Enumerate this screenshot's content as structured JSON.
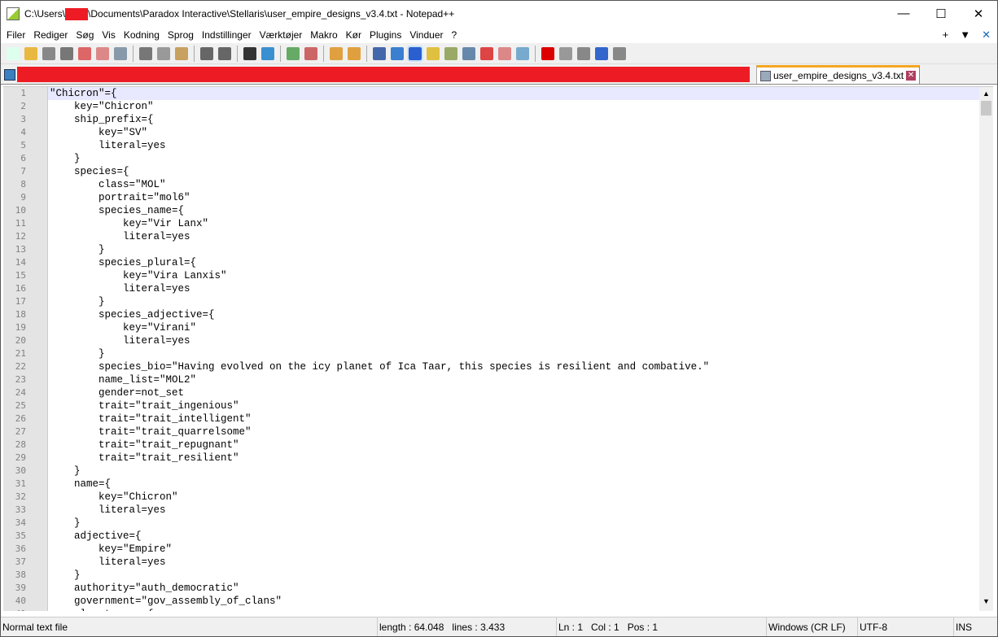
{
  "window": {
    "title_prefix": "C:\\Users\\",
    "title_suffix": "\\Documents\\Paradox Interactive\\Stellaris\\user_empire_designs_v3.4.txt - Notepad++",
    "minimize": "—",
    "maximize": "☐",
    "close": "✕"
  },
  "menu": [
    "Filer",
    "Rediger",
    "Søg",
    "Vis",
    "Kodning",
    "Sprog",
    "Indstillinger",
    "Værktøjer",
    "Makro",
    "Kør",
    "Plugins",
    "Vinduer",
    "?"
  ],
  "menu_right": {
    "plus": "+",
    "down": "▼",
    "close": "✕"
  },
  "tab": {
    "label": "user_empire_designs_v3.4.txt",
    "close": "✕"
  },
  "code_lines": [
    "\"Chicron\"={",
    "    key=\"Chicron\"",
    "    ship_prefix={",
    "        key=\"SV\"",
    "        literal=yes",
    "    }",
    "    species={",
    "        class=\"MOL\"",
    "        portrait=\"mol6\"",
    "        species_name={",
    "            key=\"Vir Lanx\"",
    "            literal=yes",
    "        }",
    "        species_plural={",
    "            key=\"Vira Lanxis\"",
    "            literal=yes",
    "        }",
    "        species_adjective={",
    "            key=\"Virani\"",
    "            literal=yes",
    "        }",
    "        species_bio=\"Having evolved on the icy planet of Ica Taar, this species is resilient and combative.\"",
    "        name_list=\"MOL2\"",
    "        gender=not_set",
    "        trait=\"trait_ingenious\"",
    "        trait=\"trait_intelligent\"",
    "        trait=\"trait_quarrelsome\"",
    "        trait=\"trait_repugnant\"",
    "        trait=\"trait_resilient\"",
    "    }",
    "    name={",
    "        key=\"Chicron\"",
    "        literal=yes",
    "    }",
    "    adjective={",
    "        key=\"Empire\"",
    "        literal=yes",
    "    }",
    "    authority=\"auth_democratic\"",
    "    government=\"gov_assembly_of_clans\"",
    "    planet_name={"
  ],
  "status": {
    "type": "Normal text file",
    "length": "length : 64.048",
    "lines": "lines : 3.433",
    "ln": "Ln : 1",
    "col": "Col : 1",
    "pos": "Pos : 1",
    "eol": "Windows (CR LF)",
    "encoding": "UTF-8",
    "mode": "INS"
  }
}
